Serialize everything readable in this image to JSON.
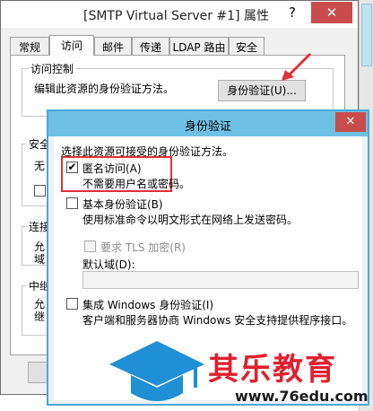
{
  "main_window": {
    "title": "[SMTP Virtual Server #1] 属性",
    "help_label": "?",
    "close_label": "✕",
    "tabs": [
      {
        "label": "常规"
      },
      {
        "label": "访问"
      },
      {
        "label": "邮件"
      },
      {
        "label": "传递"
      },
      {
        "label": "LDAP 路由"
      },
      {
        "label": "安全"
      }
    ],
    "access_control": {
      "group_label": "访问控制",
      "description": "编辑此资源的身份验证方法。",
      "auth_button": "身份验证(U)..."
    },
    "partial_labels": {
      "secure": "安全",
      "none": "无",
      "connect": "连接",
      "allow1": "允",
      "domain1": "域",
      "relay": "中继",
      "allow2": "允",
      "after": "继"
    }
  },
  "auth_dialog": {
    "title": "身份验证",
    "close_label": "✕",
    "intro": "选择此资源可接受的身份验证方法。",
    "anonymous": {
      "label": "匿名访问(A)",
      "checked_mark": "✔",
      "description": "不需要用户名或密码。"
    },
    "basic": {
      "label": "基本身份验证(B)",
      "description": "使用标准命令以明文形式在网络上发送密码。",
      "tls_label": "要求 TLS 加密(R)",
      "default_domain_label": "默认域(D):",
      "default_domain_value": ""
    },
    "windows": {
      "label": "集成 Windows 身份验证(I)",
      "description": "客户端和服务器协商 Windows 安全支持提供程序接口。"
    }
  },
  "watermark": {
    "brand": "其乐教育",
    "url": "www.76edu.com"
  },
  "colors": {
    "dialog_title_bar": "#6ec1e4",
    "close_button": "#c94c4c",
    "highlight": "#e0303a",
    "watermark_red": "#e0202e",
    "watermark_blue": "#1f8fd6"
  }
}
